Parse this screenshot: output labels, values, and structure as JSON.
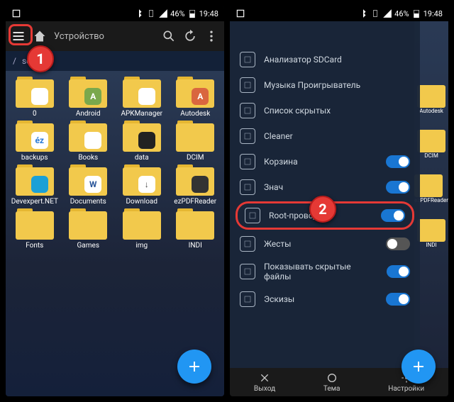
{
  "statusbar": {
    "battery": "46%",
    "time": "19:48"
  },
  "left": {
    "toolbar": {
      "device": "Устройство"
    },
    "callout": "1",
    "breadcrumb": {
      "root": "/",
      "path": "sdcard"
    },
    "folders": [
      {
        "label": "0",
        "badge": "",
        "badgeBg": "#fff"
      },
      {
        "label": "Android",
        "badge": "A",
        "badgeBg": "#7aa84c",
        "badgeFg": "#fff"
      },
      {
        "label": "APKManager",
        "badge": "",
        "badgeBg": "#fff"
      },
      {
        "label": "Autodesk",
        "badge": "A",
        "badgeBg": "#d9663f",
        "badgeFg": "#fff"
      },
      {
        "label": "backups",
        "badge": "éz",
        "badgeBg": "#fff",
        "badgeFg": "#2b7bd6"
      },
      {
        "label": "Books",
        "badge": "",
        "badgeBg": "#fff"
      },
      {
        "label": "data",
        "badge": "",
        "badgeBg": "#222",
        "badgeFg": "#fff"
      },
      {
        "label": "DCIM",
        "badge": "",
        "badgeBg": "#f2c94c"
      },
      {
        "label": "Devexpert.NET",
        "badge": "",
        "badgeBg": "#1ba0d6",
        "wrap": true
      },
      {
        "label": "Documents",
        "badge": "W",
        "badgeBg": "#fff",
        "badgeFg": "#2b579a",
        "wrap": true
      },
      {
        "label": "Download",
        "badge": "↓",
        "badgeBg": "#fff",
        "badgeFg": "#444"
      },
      {
        "label": "ezPDFReader",
        "badge": "",
        "badgeBg": "#333",
        "wrap": true
      },
      {
        "label": "Fonts",
        "badge": "",
        "badgeBg": "#f2c94c"
      },
      {
        "label": "Games",
        "badge": "",
        "badgeBg": "#f2c94c"
      },
      {
        "label": "img",
        "badge": "",
        "badgeBg": "#f2c94c"
      },
      {
        "label": "INDI",
        "badge": "",
        "badgeBg": "#f2c94c"
      }
    ]
  },
  "right": {
    "callout": "2",
    "drawer": [
      {
        "label": "Анализатор SDCard",
        "toggle": null
      },
      {
        "label": "Музыка Проигрыватель",
        "toggle": null
      },
      {
        "label": "Список скрытых",
        "toggle": null
      },
      {
        "label": "Cleaner",
        "toggle": null
      },
      {
        "label": "Корзина",
        "toggle": true
      },
      {
        "label": "Знач",
        "toggle": true
      },
      {
        "label": "Root-проводник",
        "toggle": true,
        "highlight": true
      },
      {
        "label": "Жесты",
        "toggle": false
      },
      {
        "label": "Показывать скрытые файлы",
        "toggle": true
      },
      {
        "label": "Эскизы",
        "toggle": true
      }
    ],
    "bottombar": [
      {
        "label": "Выход"
      },
      {
        "label": "Тема"
      },
      {
        "label": "Настройки"
      }
    ],
    "peek": [
      {
        "label": "Autodesk"
      },
      {
        "label": "DCIM"
      },
      {
        "label": "ezPDFReader"
      },
      {
        "label": "INDI"
      }
    ]
  }
}
